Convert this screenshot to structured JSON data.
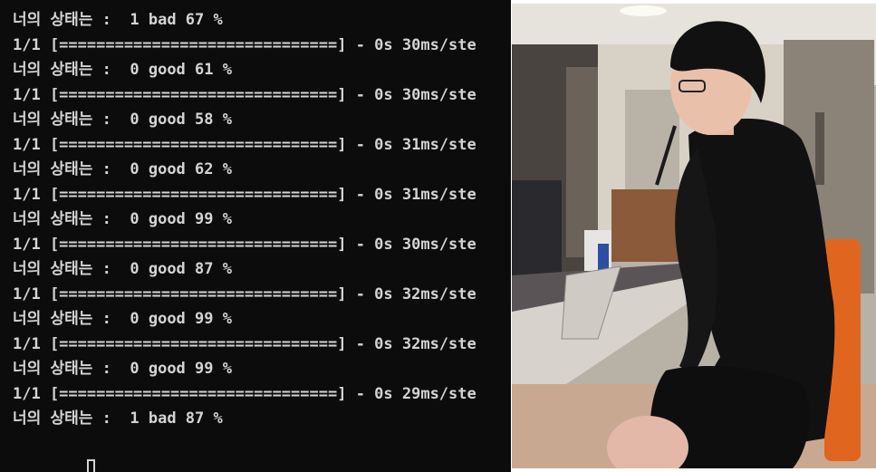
{
  "terminal": {
    "lines": [
      "너의 상태는 :  1 bad 67 %",
      "1/1 [==============================] - 0s 30ms/ste",
      "너의 상태는 :  0 good 61 %",
      "1/1 [==============================] - 0s 30ms/ste",
      "너의 상태는 :  0 good 58 %",
      "1/1 [==============================] - 0s 31ms/ste",
      "너의 상태는 :  0 good 62 %",
      "1/1 [==============================] - 0s 31ms/ste",
      "너의 상태는 :  0 good 99 %",
      "1/1 [==============================] - 0s 30ms/ste",
      "너의 상태는 :  0 good 87 %",
      "1/1 [==============================] - 0s 32ms/ste",
      "너의 상태는 :  0 good 99 %",
      "1/1 [==============================] - 0s 32ms/ste",
      "너의 상태는 :  0 good 99 %",
      "1/1 [==============================] - 0s 29ms/ste",
      "너의 상태는 :  1 bad 87 %"
    ],
    "cursor_icon": "block-cursor-icon",
    "colors": {
      "background": "#0c0c0c",
      "text": "#d4d4d4"
    }
  },
  "webcam": {
    "icon": "webcam-frame-image",
    "colors": {
      "wall": "#d8d2c6",
      "shirt": "#111111",
      "chair": "#e0661f"
    }
  }
}
